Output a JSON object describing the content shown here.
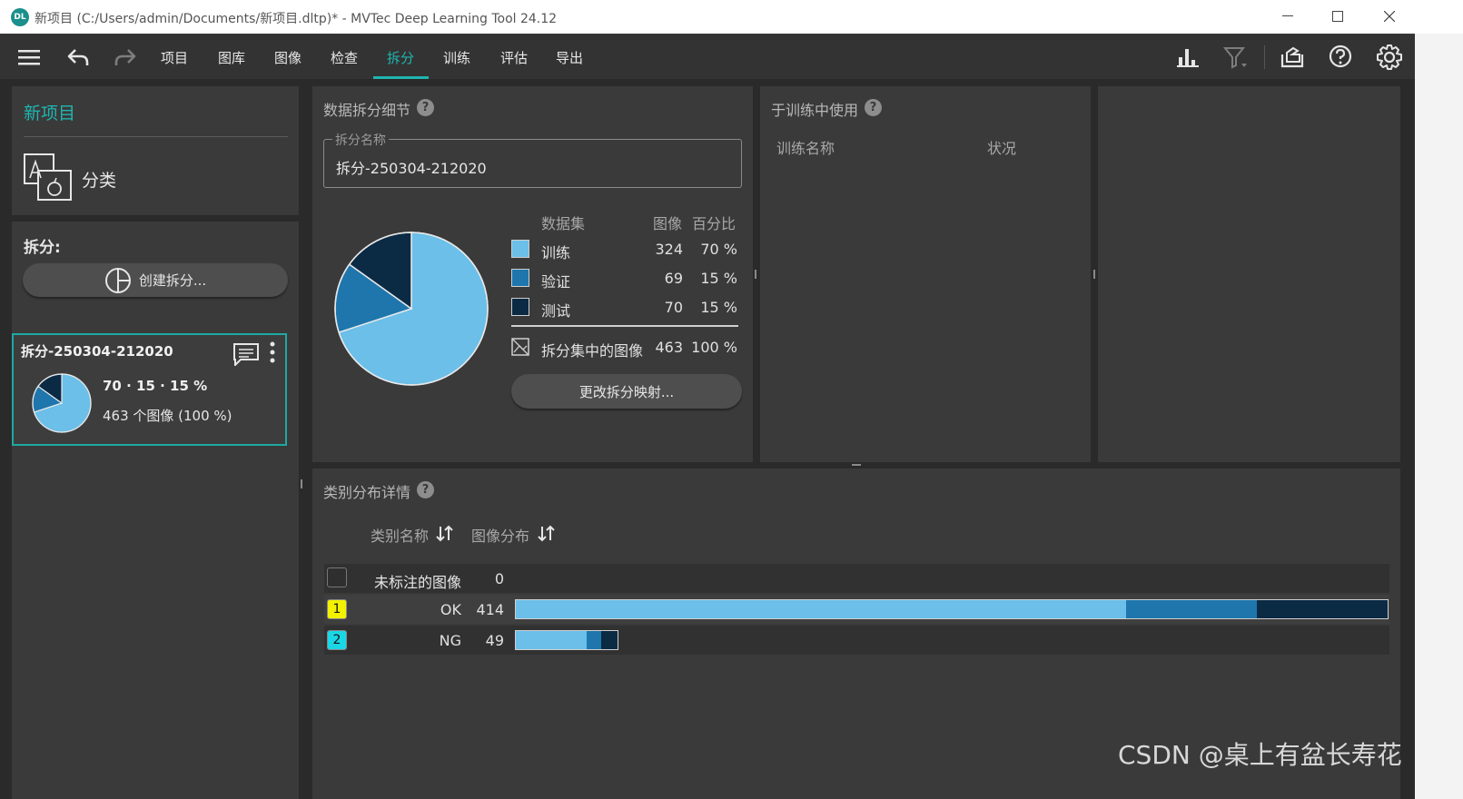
{
  "window": {
    "title": "新项目 (C:/Users/admin/Documents/新项目.dltp)* - MVTec Deep Learning Tool 24.12",
    "logo_text": "DL"
  },
  "toolbar": {
    "menu": [
      "项目",
      "图库",
      "图像",
      "检查",
      "拆分",
      "训练",
      "评估",
      "导出"
    ],
    "active": "拆分"
  },
  "left_panel": {
    "project_name": "新项目",
    "task_type": "分类",
    "split_section_label": "拆分:",
    "create_split_button": "创建拆分...",
    "split_card": {
      "name": "拆分-250304-212020",
      "ratio_text": "70 · 15 · 15 %",
      "image_count_text": "463 个图像 (100 %)"
    }
  },
  "split_details": {
    "title": "数据拆分细节",
    "split_name_label": "拆分名称",
    "split_name_value": "拆分-250304-212020",
    "table_headers": {
      "dataset": "数据集",
      "images": "图像",
      "percent": "百分比"
    },
    "rows": [
      {
        "label": "训练",
        "images": "324",
        "percent": "70 %",
        "color": "#6bbfe8"
      },
      {
        "label": "验证",
        "images": "69",
        "percent": "15 %",
        "color": "#1e76ad"
      },
      {
        "label": "测试",
        "images": "70",
        "percent": "15 %",
        "color": "#0b2a44"
      }
    ],
    "total": {
      "label": "拆分集中的图像",
      "images": "463",
      "percent": "100 %"
    },
    "change_mapping_button": "更改拆分映射..."
  },
  "training_usage": {
    "title": "于训练中使用",
    "col_training_name": "训练名称",
    "col_status": "状况"
  },
  "class_distribution": {
    "title": "类别分布详情",
    "col_class_name": "类别名称",
    "col_image_distribution": "图像分布",
    "rows": [
      {
        "badge": "",
        "badge_color": "#2f2f2f",
        "name": "未标注的图像",
        "count": "0"
      },
      {
        "badge": "1",
        "badge_color": "#f2f200",
        "name": "OK",
        "count": "414",
        "train": 290,
        "val": 62,
        "test": 62
      },
      {
        "badge": "2",
        "badge_color": "#1ad7e6",
        "name": "NG",
        "count": "49",
        "train": 34,
        "val": 7,
        "test": 8
      }
    ]
  },
  "chart_data": {
    "type": "pie",
    "categories": [
      "训练",
      "验证",
      "测试"
    ],
    "values": [
      324,
      69,
      70
    ],
    "colors": [
      "#6bbfe8",
      "#1e76ad",
      "#0b2a44"
    ]
  },
  "watermark": "CSDN @桌上有盆长寿花"
}
